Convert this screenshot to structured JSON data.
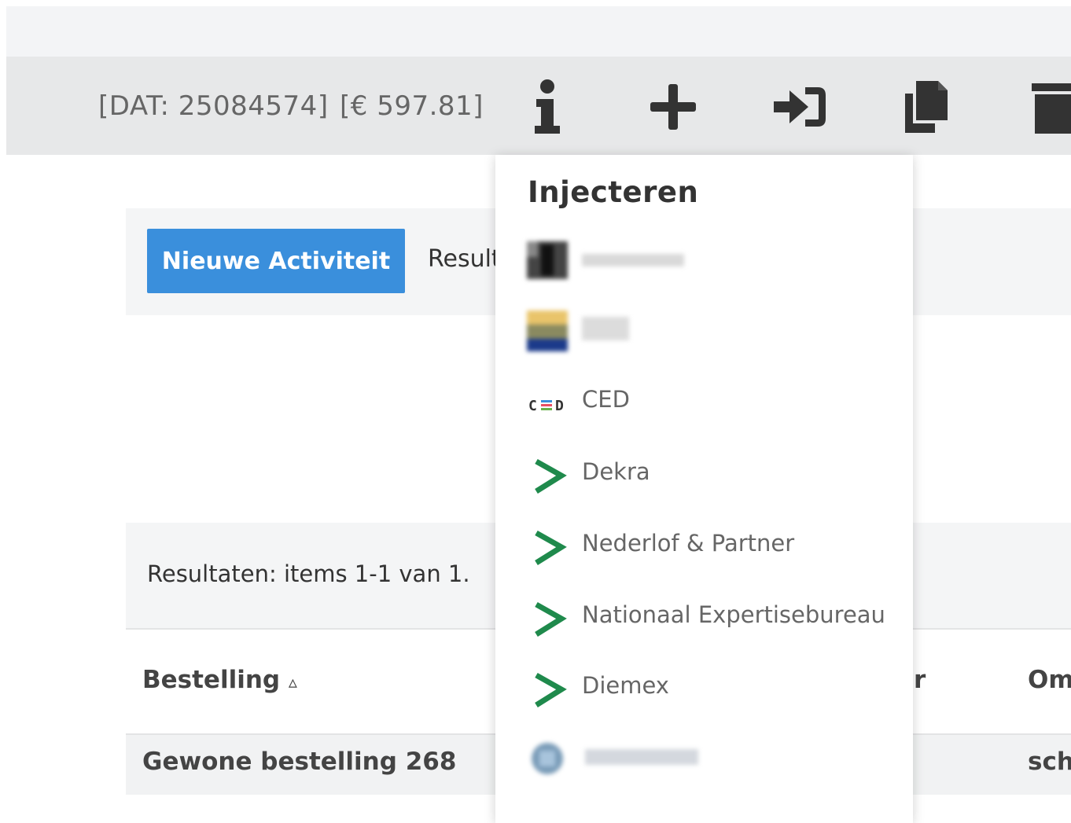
{
  "toolbar": {
    "dat_label": "[DAT: 25084574]",
    "price_label": "[€ 597.81]",
    "icons": [
      "info-icon",
      "plus-icon",
      "sign-in-icon",
      "copy-icon",
      "trash-icon"
    ]
  },
  "actions": {
    "new_activity_label": "Nieuwe Activiteit",
    "results_partial": "Result"
  },
  "results": {
    "summary": "Resultaten: items 1-1 van 1."
  },
  "table": {
    "columns": [
      "Bestelling",
      "r",
      "Om"
    ],
    "sort_indicator": "▵",
    "rows": [
      {
        "bestelling": "Gewone bestelling 268",
        "om": "sch"
      }
    ]
  },
  "dropdown": {
    "title": "Injecteren",
    "items": [
      {
        "label": "",
        "icon": "redacted-logo-icon"
      },
      {
        "label": "",
        "icon": "redacted-logo-icon"
      },
      {
        "label": "CED",
        "icon": "ced-logo-icon"
      },
      {
        "label": "Dekra",
        "icon": "green-arrow-icon"
      },
      {
        "label": "Nederlof & Partner",
        "icon": "green-arrow-icon"
      },
      {
        "label": "Nationaal Expertisebureau",
        "icon": "green-arrow-icon"
      },
      {
        "label": "Diemex",
        "icon": "green-arrow-icon"
      },
      {
        "label": "",
        "icon": "redacted-logo-icon"
      }
    ]
  },
  "colors": {
    "primary_button": "#3a8fdc",
    "toolbar_bg": "#e7e8e9",
    "arrow_green": "#1f8a4c",
    "icon_dark": "#333333"
  }
}
